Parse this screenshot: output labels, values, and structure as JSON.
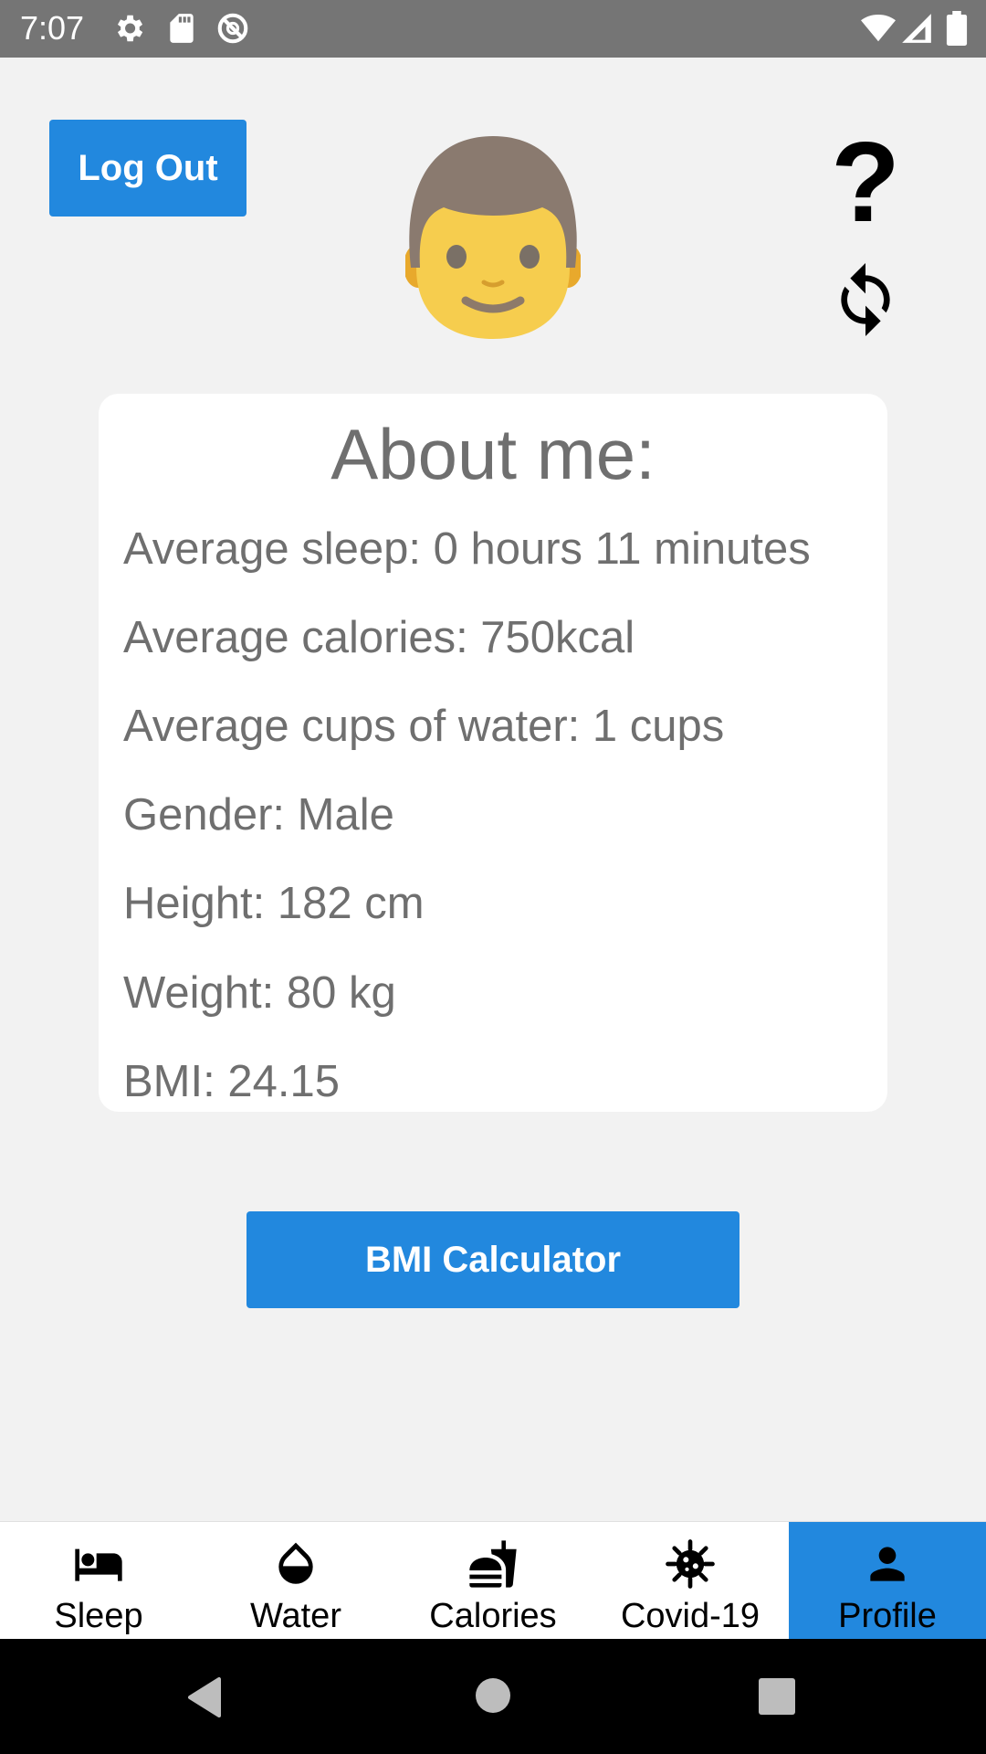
{
  "status_bar": {
    "time": "7:07",
    "left_icons": [
      "gear-icon",
      "sd-card-icon",
      "do-not-disturb-icon"
    ],
    "right_icons": [
      "wifi-icon",
      "signal-icon",
      "battery-icon"
    ]
  },
  "header": {
    "logout_label": "Log Out",
    "avatar_icon": "man-face-emoji",
    "help_symbol": "?",
    "refresh_icon": "refresh-icon"
  },
  "about": {
    "title": "About me:",
    "rows": [
      "Average sleep: 0 hours 11 minutes",
      "Average calories: 750kcal",
      "Average cups of water: 1 cups",
      "Gender: Male",
      "Height: 182 cm",
      "Weight: 80 kg",
      "BMI: 24.15"
    ]
  },
  "bmi_button_label": "BMI Calculator",
  "tabs": [
    {
      "label": "Sleep",
      "icon": "bed-icon",
      "active": false
    },
    {
      "label": "Water",
      "icon": "water-drop-icon",
      "active": false
    },
    {
      "label": "Calories",
      "icon": "fastfood-icon",
      "active": false
    },
    {
      "label": "Covid-19",
      "icon": "virus-icon",
      "active": false
    },
    {
      "label": "Profile",
      "icon": "person-icon",
      "active": true
    }
  ],
  "colors": {
    "accent": "#2288de",
    "background": "#f2f2f2",
    "text_gray": "#6f6f6f",
    "status_bar": "#757575"
  }
}
